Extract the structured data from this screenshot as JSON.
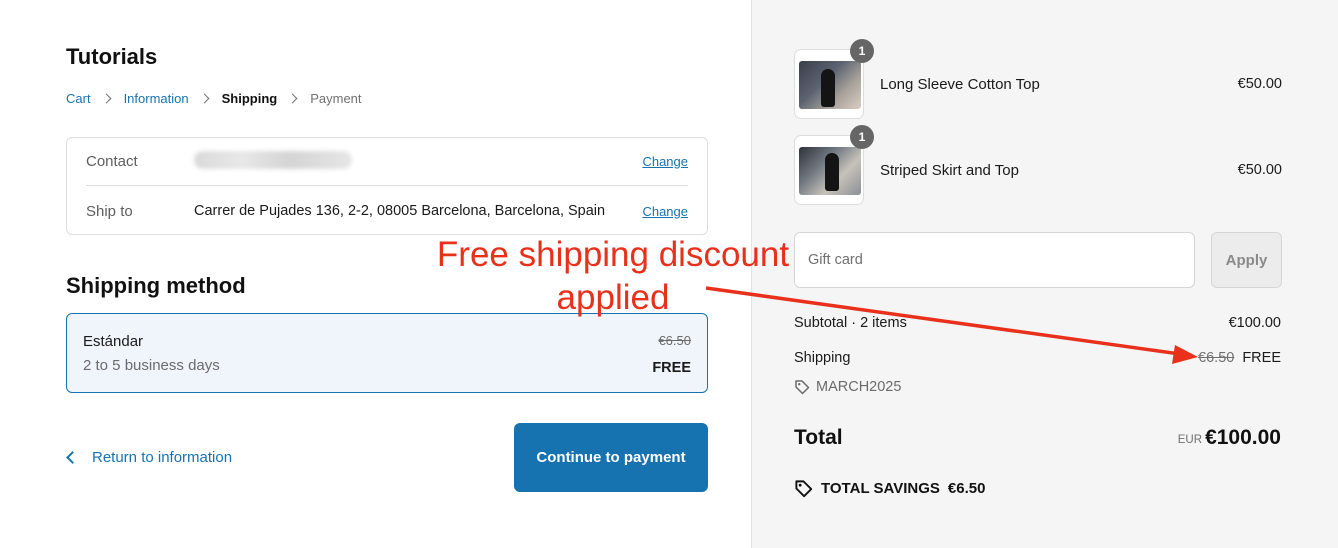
{
  "store": {
    "name": "Tutorials"
  },
  "breadcrumb": {
    "items": [
      {
        "label": "Cart",
        "state": "link"
      },
      {
        "label": "Information",
        "state": "link"
      },
      {
        "label": "Shipping",
        "state": "current"
      },
      {
        "label": "Payment",
        "state": "future"
      }
    ]
  },
  "review": {
    "contact_label": "Contact",
    "contact_change": "Change",
    "shipto_label": "Ship to",
    "shipto_value": "Carrer de Pujades 136, 2-2, 08005 Barcelona, Barcelona, Spain",
    "shipto_change": "Change"
  },
  "shipping_method": {
    "title": "Shipping method",
    "name": "Estándar",
    "subtitle": "2 to 5 business days",
    "original_price": "€6.50",
    "price": "FREE"
  },
  "actions": {
    "return_label": "Return to information",
    "continue_label": "Continue to payment"
  },
  "order": {
    "items": [
      {
        "name": "Long Sleeve Cotton Top",
        "price": "€50.00",
        "quantity": "1"
      },
      {
        "name": "Striped Skirt and Top",
        "price": "€50.00",
        "quantity": "1"
      }
    ],
    "gift_card_placeholder": "Gift card",
    "apply_label": "Apply",
    "subtotal_label": "Subtotal · 2 items",
    "subtotal_value": "€100.00",
    "shipping_label": "Shipping",
    "shipping_original": "€6.50",
    "shipping_value": "FREE",
    "discount_code": "MARCH2025",
    "total_label": "Total",
    "total_currency": "EUR",
    "total_value": "€100.00",
    "savings_label": "TOTAL SAVINGS",
    "savings_value": "€6.50"
  },
  "annotation": {
    "text_line1": "Free shipping discount",
    "text_line2": "applied",
    "color": "#e8301b"
  },
  "colors": {
    "accent": "#1773b0",
    "sidebar_bg": "#f5f5f5",
    "selected_bg": "#f0f5fc"
  }
}
